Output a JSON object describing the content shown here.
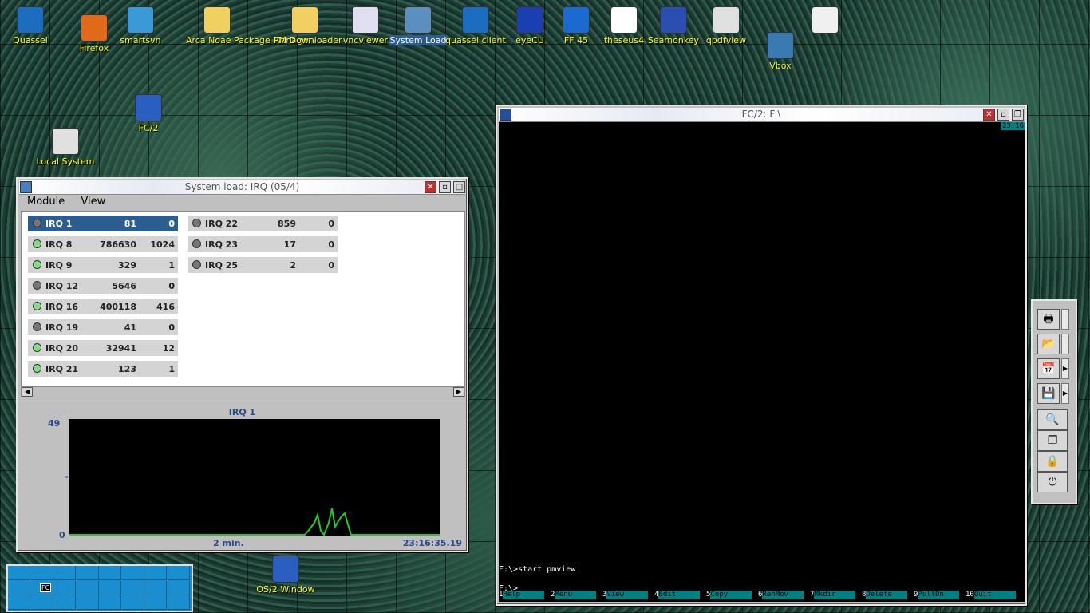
{
  "desktop": {
    "icons": [
      {
        "label": "Quassel",
        "icon": "quassel-icon",
        "color": "#1c6dc0"
      },
      {
        "label": "Firefox",
        "icon": "firefox-icon",
        "color": "#e06a1a"
      },
      {
        "label": "smartsvn",
        "icon": "smartsvn-icon",
        "color": "#3a9ad8"
      },
      {
        "label": "Arca Noae Package Manager",
        "icon": "folder-icon",
        "color": "#f0d060"
      },
      {
        "label": "PM Downloader",
        "icon": "folder-icon",
        "color": "#f0d060"
      },
      {
        "label": "vncviewer",
        "icon": "vnc-icon",
        "color": "#e0e0f0"
      },
      {
        "label": "System Load",
        "icon": "system-load-icon",
        "color": "#5a8fc0"
      },
      {
        "label": "quassel client",
        "icon": "quassel-icon",
        "color": "#1c6dc0"
      },
      {
        "label": "eyeCU",
        "icon": "eyecu-icon",
        "color": "#1a3fb0"
      },
      {
        "label": "FF 45",
        "icon": "globe-icon",
        "color": "#1a6ad0"
      },
      {
        "label": "theseus4",
        "icon": "theseus-icon",
        "color": "#ffffff"
      },
      {
        "label": "Seamonkey",
        "icon": "seamonkey-icon",
        "color": "#2a4fb0"
      },
      {
        "label": "qpdfview",
        "icon": "pdf-viewer-icon",
        "color": "#e0e0e0"
      },
      {
        "label": "",
        "icon": "usb-drive-icon",
        "color": "#f0f0f0"
      },
      {
        "label": "Vbox",
        "icon": "vbox-icon",
        "color": "#3a7ab0"
      },
      {
        "label": "FC/2",
        "icon": "fc2-icon",
        "color": "#2a5fc0"
      },
      {
        "label": "Local System",
        "icon": "computer-icon",
        "color": "#e0e0e0"
      },
      {
        "label": "OS/2 Window",
        "icon": "os2-window-icon",
        "color": "#2a5fc0"
      }
    ]
  },
  "sysload": {
    "title": "System load: IRQ (05/4)",
    "menu": [
      {
        "label": "Module"
      },
      {
        "label": "View"
      }
    ],
    "irqs": [
      {
        "name": "IRQ 1",
        "count": "81",
        "rate": "0",
        "active": false,
        "selected": true
      },
      {
        "name": "IRQ 8",
        "count": "786630",
        "rate": "1024",
        "active": true,
        "selected": false
      },
      {
        "name": "IRQ 9",
        "count": "329",
        "rate": "1",
        "active": true,
        "selected": false
      },
      {
        "name": "IRQ 12",
        "count": "5646",
        "rate": "0",
        "active": false,
        "selected": false
      },
      {
        "name": "IRQ 16",
        "count": "400118",
        "rate": "416",
        "active": true,
        "selected": false
      },
      {
        "name": "IRQ 19",
        "count": "41",
        "rate": "0",
        "active": false,
        "selected": false
      },
      {
        "name": "IRQ 20",
        "count": "32941",
        "rate": "12",
        "active": true,
        "selected": false
      },
      {
        "name": "IRQ 21",
        "count": "123",
        "rate": "1",
        "active": true,
        "selected": false
      },
      {
        "name": "IRQ 22",
        "count": "859",
        "rate": "0",
        "active": false,
        "selected": false
      },
      {
        "name": "IRQ 23",
        "count": "17",
        "rate": "0",
        "active": false,
        "selected": false
      },
      {
        "name": "IRQ 25",
        "count": "2",
        "rate": "0",
        "active": false,
        "selected": false
      }
    ],
    "graph": {
      "title": "IRQ 1",
      "y_max": "49",
      "y_mid": "\"",
      "y_min": "0",
      "x_left": "2 min.",
      "x_right": "23:16:35.19",
      "line_color": "#22cc22"
    }
  },
  "fc2": {
    "title": "FC/2: F:\\",
    "clock": "23:16",
    "lines": [
      "F:\\>start pmview",
      "F:\\>"
    ],
    "fkeys": [
      {
        "num": "1",
        "label": "Help"
      },
      {
        "num": "2",
        "label": "Menu"
      },
      {
        "num": "3",
        "label": "View"
      },
      {
        "num": "4",
        "label": "Edit"
      },
      {
        "num": "5",
        "label": "Copy"
      },
      {
        "num": "6",
        "label": "RenMov"
      },
      {
        "num": "7",
        "label": "Mkdir"
      },
      {
        "num": "8",
        "label": "Delete"
      },
      {
        "num": "9",
        "label": "PullDn"
      },
      {
        "num": "10",
        "label": "Quit"
      }
    ]
  },
  "toolbar": {
    "tools": [
      {
        "icon": "printer-icon",
        "glyph": "🖶"
      },
      {
        "icon": "folder-open-icon",
        "glyph": "📂"
      },
      {
        "icon": "calendar-icon",
        "glyph": "📅"
      },
      {
        "icon": "save-disk-icon",
        "glyph": "💾"
      },
      {
        "icon": "magnifier-icon",
        "glyph": "🔍"
      },
      {
        "icon": "windows-icon",
        "glyph": "❐"
      },
      {
        "icon": "lock-icon",
        "glyph": "🔒"
      },
      {
        "icon": "shutdown-icon",
        "glyph": "⏻"
      }
    ]
  },
  "vdesk": {
    "window_label": "FC"
  }
}
